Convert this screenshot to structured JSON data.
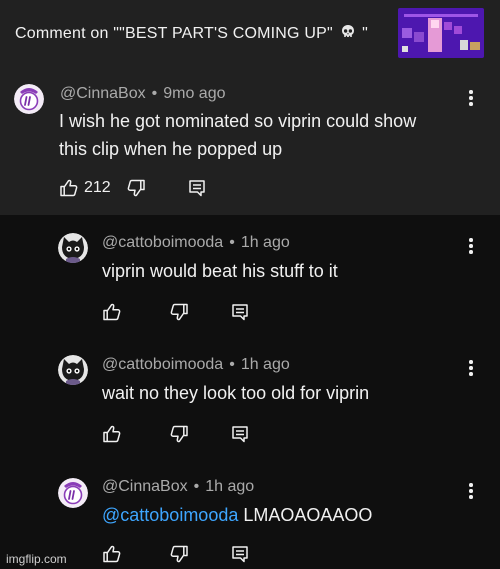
{
  "header": {
    "title_prefix": "Comment on \"\"BEST PART'S COMING UP\"",
    "title_suffix": "\"",
    "thumbnail_icon": "video-thumbnail"
  },
  "comments": [
    {
      "author": "@CinnaBox",
      "time": "9mo ago",
      "lines": [
        "I wish he got nominated so viprin could show",
        "this clip when he popped up"
      ],
      "likes": "212",
      "avatar": "cinnabox-avatar"
    },
    {
      "author": "@cattoboimooda",
      "time": "1h ago",
      "lines": [
        "viprin would beat his stuff to it"
      ],
      "avatar": "cattoboimooda-avatar"
    },
    {
      "author": "@cattoboimooda",
      "time": "1h ago",
      "lines": [
        "wait no they look too old for viprin"
      ],
      "avatar": "cattoboimooda-avatar"
    },
    {
      "author": "@CinnaBox",
      "time": "1h ago",
      "mention": "@cattoboimooda",
      "text": " LMAOAOAAOO",
      "avatar": "cinnabox-avatar"
    }
  ],
  "dot": "•",
  "watermark": "imgflip.com",
  "colors": {
    "top_bg": "#212121",
    "bottom_bg": "#0f0f0f",
    "mention": "#3ea6ff",
    "meta": "#aaaaaa"
  }
}
